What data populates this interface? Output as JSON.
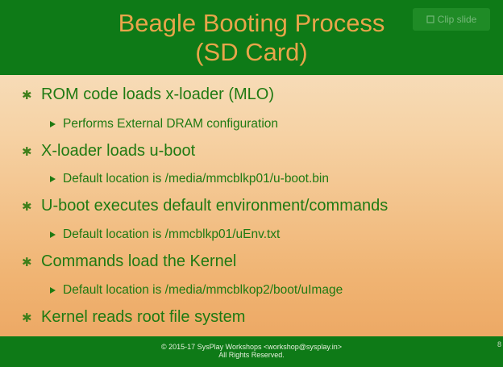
{
  "slide": {
    "title": "Beagle Booting Process\n(SD Card)",
    "clip_label": "Clip slide",
    "bullets": [
      {
        "text": "ROM code loads x-loader (MLO)",
        "sub": "Performs External DRAM configuration"
      },
      {
        "text": "X-loader loads u-boot",
        "sub": "Default location is /media/mmcblkp01/u-boot.bin"
      },
      {
        "text": "U-boot executes default environment/commands",
        "sub": "Default location is /mmcblkp01/uEnv.txt"
      },
      {
        "text": "Commands load the Kernel",
        "sub": "Default location is /media/mmcblkop2/boot/uImage"
      },
      {
        "text": "Kernel reads root file system",
        "sub": ""
      }
    ],
    "footer_line1": "© 2015-17 SysPlay Workshops <workshop@sysplay.in>",
    "footer_line2": "All Rights Reserved.",
    "page_number": "8"
  },
  "colors": {
    "header_green": "#0e7a17",
    "title_orange": "#e8a54a",
    "text_green": "#1f7a12"
  },
  "icons": {
    "bullet_level1": "asterisk",
    "bullet_level2": "triangle-right-icon",
    "clip": "clip-icon"
  }
}
